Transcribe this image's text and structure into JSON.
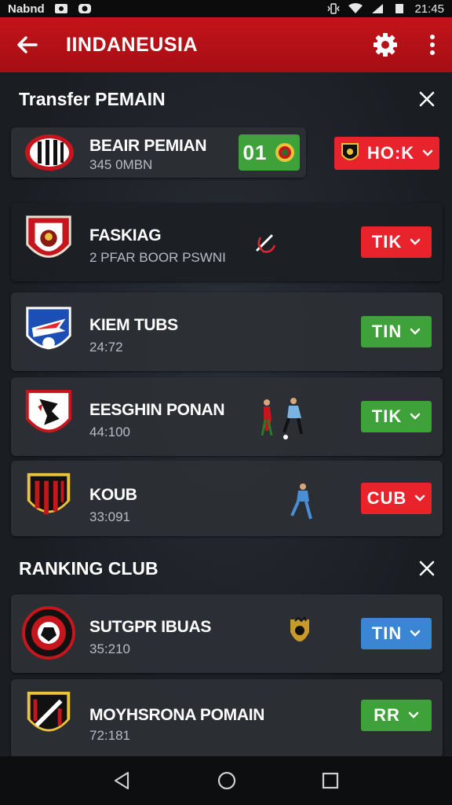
{
  "status_bar": {
    "carrier": "Nabnd",
    "time": "21:45"
  },
  "app_bar": {
    "title": "IINDANEUSIA"
  },
  "colors": {
    "brand_red": "#c4131a",
    "pill_red": "#e9232b",
    "pill_green": "#3fa13a",
    "pill_blue": "#3b86d4",
    "card_bg": "#2c2f35"
  },
  "transfer_section": {
    "title": "Transfer PEMAIN",
    "top_row": {
      "name": "BEAIR PEMIAN",
      "sub": "345 0MBN",
      "score": "01",
      "action": "HO:K"
    },
    "rows": [
      {
        "name": "FASKIAG",
        "sub": "2 PFAR BOOR PSWNI",
        "action": "TIK",
        "action_color": "red"
      },
      {
        "name": "KIEM TUBS",
        "sub": "24:72",
        "action": "TIN",
        "action_color": "green"
      },
      {
        "name": "EESGHIN PONAN",
        "sub": "44:100",
        "action": "TIK",
        "action_color": "green"
      },
      {
        "name": "KOUB",
        "sub": "33:091",
        "action": "CUB",
        "action_color": "red"
      }
    ]
  },
  "ranking_section": {
    "title": "RANKING CLUB",
    "rows": [
      {
        "name": "SUTGPR IBUAS",
        "sub": "35:210",
        "action": "TIN",
        "action_color": "blue"
      },
      {
        "name": "MOYHSRONA POMAIN",
        "sub": "72:181",
        "action": "RR",
        "action_color": "green"
      }
    ]
  },
  "icons": {
    "back": "arrow-left-icon",
    "settings": "gear-icon",
    "more": "more-vert-icon",
    "close": "close-icon",
    "dropdown": "chevron-down-icon",
    "nav": [
      "back-triangle-icon",
      "home-circle-icon",
      "recents-square-icon"
    ]
  }
}
